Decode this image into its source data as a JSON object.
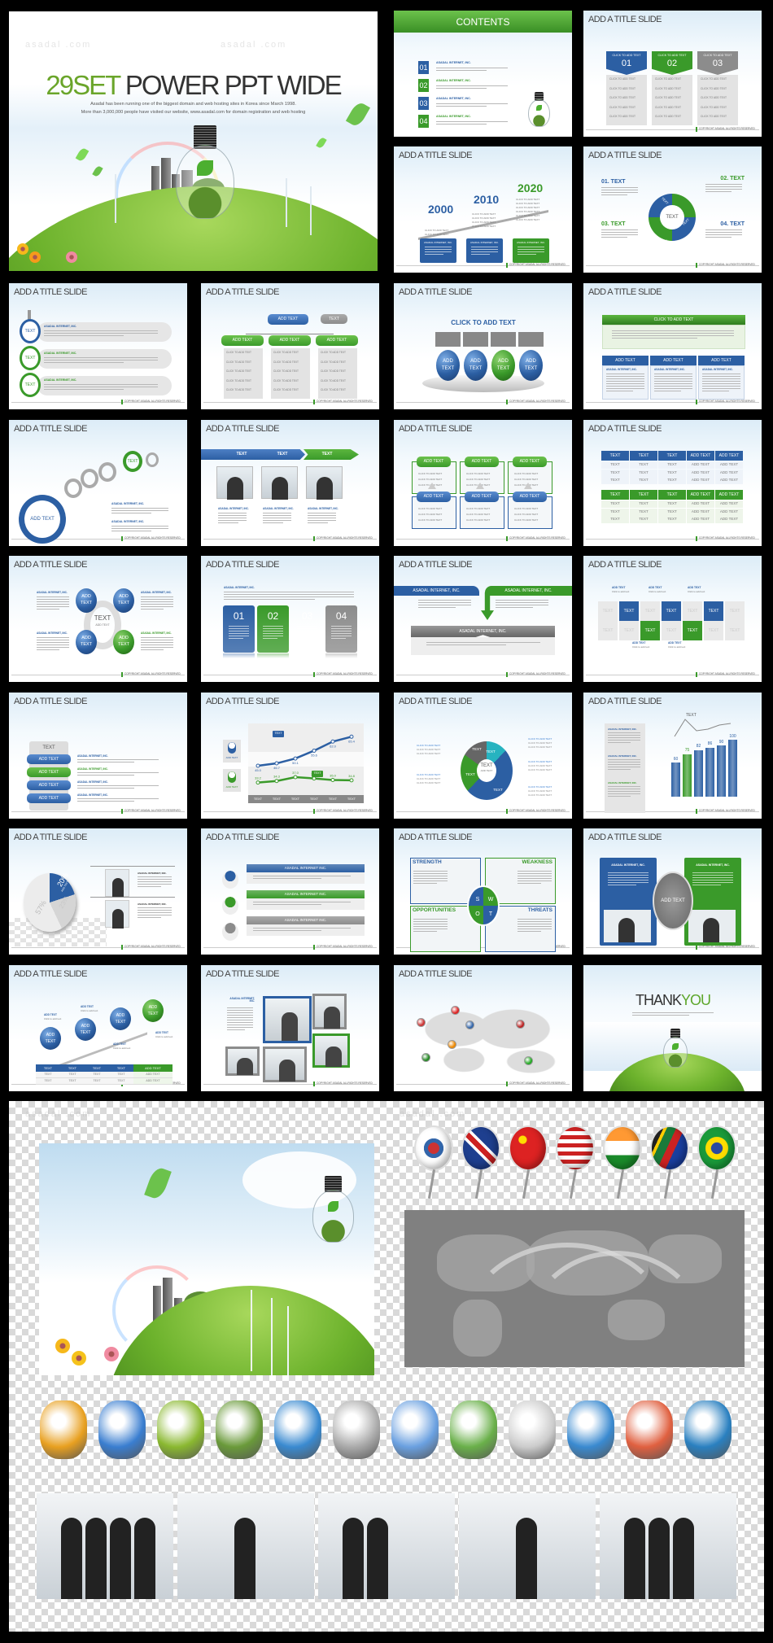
{
  "watermark": "asadal .com",
  "title_slide": {
    "title_green": "29SET",
    "title_dark": " POWER PPT WIDE",
    "line1": "Asadal has been running one of the biggest domain and web hosting sites in Korea since March 1998.",
    "line2": "More than 3,000,000 people have visited our website, www.asadal.com for domain registration and web hosting"
  },
  "common": {
    "slide_title": "ADD A TITLE SLIDE",
    "copyright": "COPYRIGHT ASADAL ALLRIGHTS RESERVED"
  },
  "colors": {
    "blue": "#2c5fa3",
    "green": "#3a9a2a",
    "gray": "#8c8c8c",
    "background": "#000000"
  },
  "slides": [
    {
      "kind": "contents",
      "heading": "CONTENTS",
      "numbers": [
        "01",
        "02",
        "03",
        "04"
      ],
      "label": "ASADAL INTERNET, INC."
    },
    {
      "kind": "three-columns",
      "header": "CLICK TO ADD TEXT",
      "numbers": [
        "01",
        "02",
        "03"
      ],
      "item": "CLICK TO ADD TEXT"
    },
    {
      "kind": "timeline",
      "years": [
        "2000",
        "2010",
        "2020"
      ],
      "item": "CLICK TO ADD TEXT",
      "box": "ASADAL INTERNET, INC."
    },
    {
      "kind": "ring",
      "labels": [
        "01. TEXT",
        "02. TEXT",
        "03. TEXT",
        "04. TEXT"
      ],
      "segment": "TEXT",
      "center": "TEXT"
    },
    {
      "kind": "vertical-circles",
      "circle": "TEXT",
      "label": "ASADAL INTERNET, INC."
    },
    {
      "kind": "org-chart",
      "top": "ADD TEXT",
      "side": "TEXT",
      "node": "ADD TEXT",
      "item": "CLICK TO ADD TEXT"
    },
    {
      "kind": "spheres",
      "heading": "CLICK TO ADD TEXT",
      "sphere_top": "ADD",
      "sphere_bottom": "TEXT"
    },
    {
      "kind": "banner-table",
      "banner": "CLICK TO ADD TEXT",
      "header": "ADD TEXT",
      "label": "ASADAL INTERNET, INC."
    },
    {
      "kind": "rings",
      "big": "ADD TEXT",
      "small": "TEXT",
      "label": "ASADAL INTERNET, INC."
    },
    {
      "kind": "photo-arrow",
      "tabs": [
        "TEXT",
        "TEXT",
        "TEXT"
      ],
      "label": "ASADAL INTERNET, INC."
    },
    {
      "kind": "box-grid",
      "header": "ADD TEXT",
      "item": "CLICK TO ADD TEXT"
    },
    {
      "kind": "tables",
      "headers": [
        "TEXT",
        "TEXT",
        "TEXT",
        "ADD TEXT",
        "ADD TEXT"
      ]
    },
    {
      "kind": "four-spheres",
      "sphere_top": "ADD",
      "sphere_bottom": "TEXT",
      "center": "TEXT",
      "center_sub": "ADD TEXT",
      "label": "ASADAL INTERNET, INC."
    },
    {
      "kind": "cards",
      "numbers": [
        "01",
        "02",
        "03",
        "04"
      ],
      "label": "ASADAL INTERNET, INC."
    },
    {
      "kind": "arrows",
      "label": "ASADAL INTERNET, INC."
    },
    {
      "kind": "text-grid",
      "cell": "TEXT",
      "add": "ADD TEXT",
      "sub": "Click to add text"
    },
    {
      "kind": "pill-list",
      "column": "TEXT",
      "pill": "ADD TEXT",
      "label": "ASADAL INTERNET, INC."
    },
    {
      "kind": "line-chart",
      "categories": [
        "TEXT",
        "TEXT",
        "TEXT",
        "TEXT",
        "TEXT",
        "TEXT"
      ],
      "series": [
        {
          "values": [
            45.0,
            46.7,
            50.1,
            55.6,
            62.0,
            65.4
          ],
          "color": "#2c5fa3"
        },
        {
          "values": [
            33.2,
            34.3,
            37.0,
            36.1,
            35.0,
            34.8
          ],
          "color": "#3a9a2a"
        }
      ],
      "callout": "TEXT",
      "icon_label": "ADD TEXT"
    },
    {
      "kind": "donut",
      "segment": "TEXT",
      "center": "TEXT",
      "center_sub": "ADD TEXT",
      "item": "CLICK TO ADD TEXT"
    },
    {
      "kind": "bar-chart",
      "values": [
        60,
        75,
        82,
        86,
        90,
        100
      ],
      "highlight_index": 1,
      "callout": "TEXT",
      "label": "ASADAL INTERNET, INC."
    },
    {
      "kind": "pie",
      "slices": [
        {
          "label": "57%",
          "value": 57
        },
        {
          "label": "20%",
          "value": 20
        },
        {
          "label": "23%",
          "value": 23
        }
      ],
      "sub": "ADD TEXT",
      "label": "ASADAL INTERNET, INC."
    },
    {
      "kind": "banners",
      "banner": "ASADAL INTERNET INC."
    },
    {
      "kind": "swot",
      "quadrants": [
        "STRENGTH",
        "WEAKNESS",
        "OPPORTUNITIES",
        "THREATS"
      ],
      "letters": [
        "S",
        "W",
        "O",
        "T"
      ]
    },
    {
      "kind": "hexagon",
      "center": "ADD TEXT",
      "label": "ASADAL INTERNET, INC."
    },
    {
      "kind": "stairs",
      "sphere_top": "ADD",
      "sphere_bottom": "TEXT",
      "add": "ADD TEXT",
      "sub": "Click to add text",
      "table_headers": [
        "TEXT",
        "TEXT",
        "TEXT",
        "TEXT",
        "ADD TEXT"
      ],
      "cell": "TEXT",
      "cell_add": "ADD TEXT"
    },
    {
      "kind": "collage",
      "label": "ASADAL INTERNET, INC."
    },
    {
      "kind": "world-map"
    },
    {
      "kind": "thank-you",
      "thank": "THANK",
      "you": "YOU"
    }
  ],
  "assets": {
    "flags": [
      "korea-flag-pin",
      "uk-flag-pin",
      "china-flag-pin",
      "usa-flag-pin",
      "india-flag-pin",
      "south-africa-flag-pin",
      "brazil-flag-pin"
    ],
    "icons": [
      "flowers-arrows-icon",
      "teacher-icon",
      "calendar-icon",
      "plant-pot-icon",
      "globe-arrow-icon",
      "magnifier-book-icon",
      "user-lock-icon",
      "user-calendar-icon",
      "user-no1-icon",
      "number-blocks-icon",
      "chart-pen-icon",
      "power-button-icon"
    ],
    "photos": [
      "business-team-photo",
      "call-center-photo",
      "globe-discussion-photo",
      "office-desk-photo",
      "finish-line-photo"
    ]
  }
}
